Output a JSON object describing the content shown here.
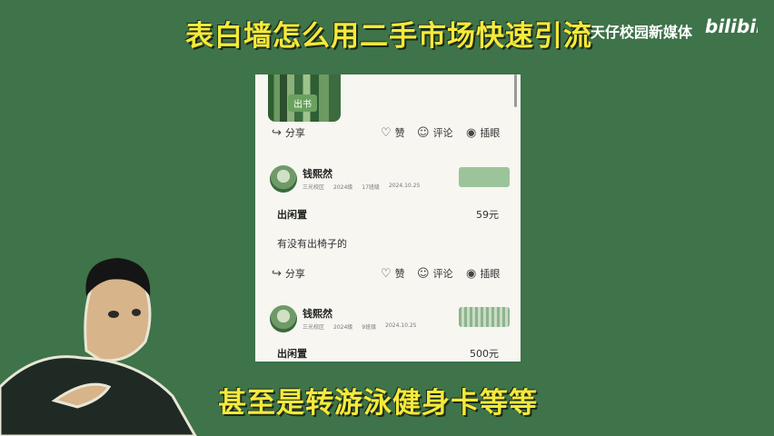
{
  "video": {
    "title": "表白墙怎么用二手市场快速引流",
    "channel": "天仔校园新媒体",
    "platform": "bilibili",
    "subtitle": "甚至是转游泳健身卡等等"
  },
  "feed": {
    "top_post": {
      "image_tag": "出书",
      "share": "分享",
      "like": "赞",
      "comment": "评论",
      "poke": "插眼"
    },
    "posts": [
      {
        "user": "钱熙然",
        "meta": [
          "三光校区",
          "2024级",
          "17班级",
          "2024.10.25"
        ],
        "category": "出闲置",
        "price": "59元",
        "content": "有没有出椅子的",
        "share": "分享",
        "like": "赞",
        "comment": "评论",
        "poke": "插眼"
      },
      {
        "user": "钱熙然",
        "meta": [
          "三光校区",
          "2024级",
          "9班级",
          "2024.10.25"
        ],
        "category": "出闲置",
        "price": "500元"
      }
    ]
  },
  "icons": [
    "share-icon",
    "heart-icon",
    "comment-icon",
    "eye-icon"
  ],
  "colors": {
    "background": "#3f7349",
    "title": "#f5e93a",
    "phone_bg": "#f7f6f1"
  }
}
